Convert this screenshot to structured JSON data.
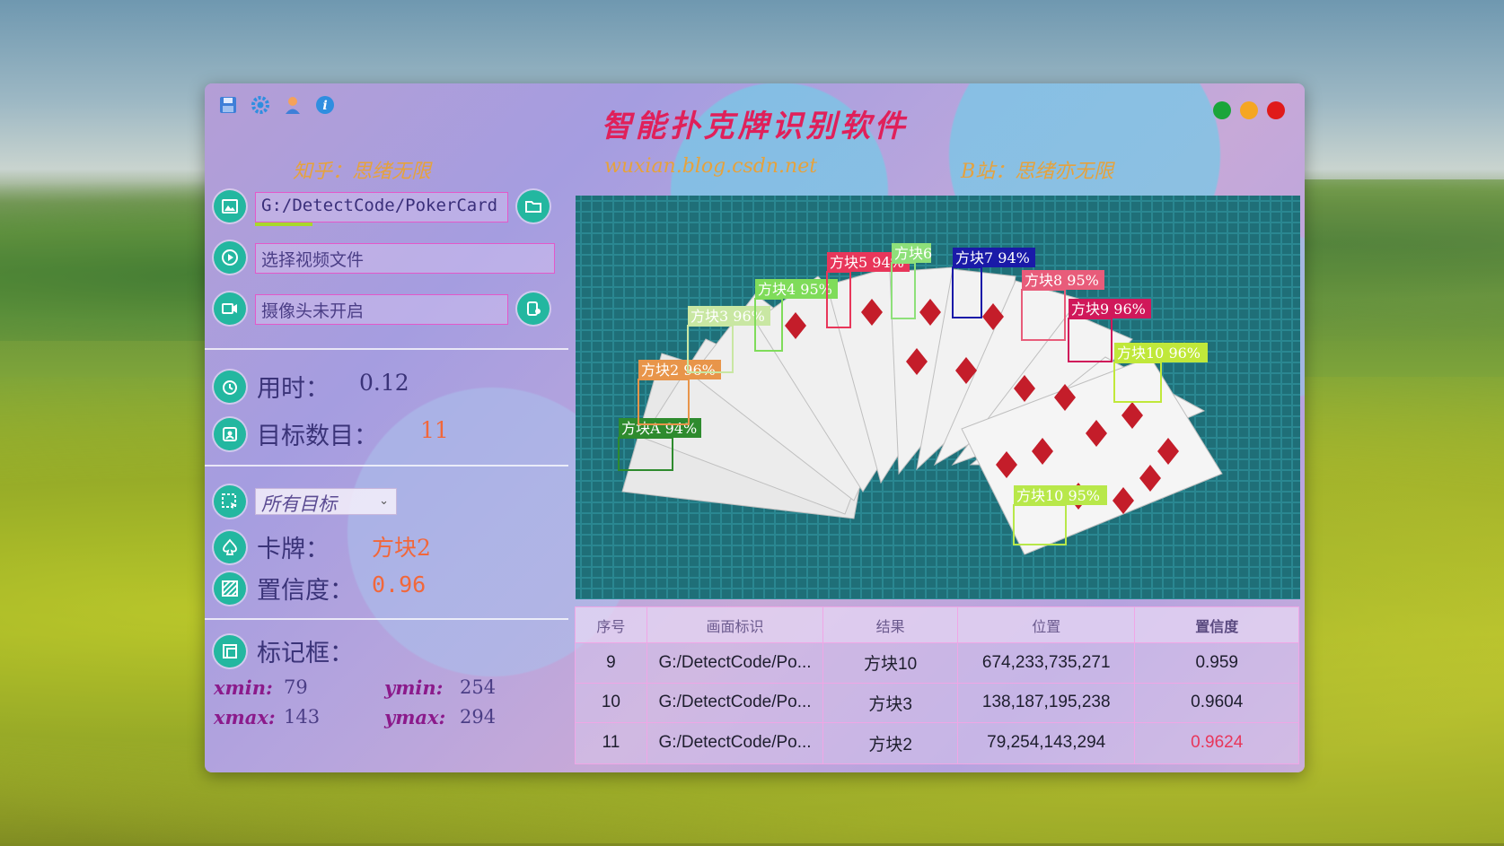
{
  "app": {
    "title": "智能扑克牌识别软件",
    "zhihu": "知乎：思绪无限",
    "blog": "wuxian.blog.csdn.net",
    "bilibili": "B站：思绪亦无限",
    "traffic_colors": [
      "#1aa53a",
      "#f5a623",
      "#e01a1a"
    ]
  },
  "inputs": {
    "image_path": "G:/DetectCode/PokerCard",
    "video_placeholder": "选择视频文件",
    "camera_status": "摄像头未开启"
  },
  "stats": {
    "time_label": "用时：",
    "time_value": "0.12",
    "count_label": "目标数目：",
    "count_value": "11"
  },
  "selection": {
    "target_select": "所有目标",
    "card_label": "卡牌：",
    "card_value": "方块2",
    "conf_label": "置信度：",
    "conf_value": "0.96"
  },
  "box": {
    "label": "标记框：",
    "xmin_label": "xmin:",
    "xmin": "79",
    "ymin_label": "ymin:",
    "ymin": "254",
    "xmax_label": "xmax:",
    "xmax": "143",
    "ymax_label": "ymax:",
    "ymax": "294"
  },
  "detections": [
    {
      "label": "方块A 94%",
      "color": "#2e8b2e"
    },
    {
      "label": "方块2 96%",
      "color": "#e8954a"
    },
    {
      "label": "方块3 96%",
      "color": "#c9e7a3"
    },
    {
      "label": "方块4 95%",
      "color": "#7fdc5a"
    },
    {
      "label": "方块5 94%",
      "color": "#e8365a"
    },
    {
      "label": "方块6",
      "color": "#8ee07a"
    },
    {
      "label": "方块7 94%",
      "color": "#1a1aa8"
    },
    {
      "label": "方块8 95%",
      "color": "#e85c7a"
    },
    {
      "label": "方块9 96%",
      "color": "#d0185a"
    },
    {
      "label": "方块10 96%",
      "color": "#c0e83a"
    },
    {
      "label": "方块10 95%",
      "color": "#b8e84a"
    }
  ],
  "table": {
    "headers": [
      "序号",
      "画面标识",
      "结果",
      "位置",
      "置信度"
    ],
    "rows": [
      [
        "9",
        "G:/DetectCode/Po...",
        "方块10",
        "674,233,735,271",
        "0.959"
      ],
      [
        "10",
        "G:/DetectCode/Po...",
        "方块3",
        "138,187,195,238",
        "0.9604"
      ],
      [
        "11",
        "G:/DetectCode/Po...",
        "方块2",
        "79,254,143,294",
        "0.9624"
      ]
    ],
    "highlight_color": "#e8365a"
  }
}
